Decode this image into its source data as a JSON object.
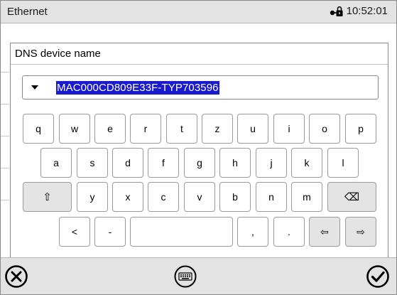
{
  "topbar": {
    "title": "Ethernet",
    "time": "10:52:01",
    "lock_icon": "network-lock-icon"
  },
  "dialog": {
    "title": "DNS device name",
    "field": {
      "value": "MAC000CD809E33F-TYP703596",
      "selected": true,
      "dropdown_icon": "chevron-down-icon"
    }
  },
  "keyboard": {
    "row1": [
      "q",
      "w",
      "e",
      "r",
      "t",
      "z",
      "u",
      "i",
      "o",
      "p"
    ],
    "row2": [
      "a",
      "s",
      "d",
      "f",
      "g",
      "h",
      "j",
      "k",
      "l"
    ],
    "row3": [
      "⇧",
      "y",
      "x",
      "c",
      "v",
      "b",
      "n",
      "m",
      "⌫"
    ],
    "row4": [
      "<",
      "-",
      "",
      ",",
      ".",
      "⇦",
      "⇨"
    ]
  },
  "bottombar": {
    "cancel_icon": "close-circle-icon",
    "keyboard_icon": "keyboard-icon",
    "confirm_icon": "checkmark-circle-icon"
  },
  "colors": {
    "bar_bg": "#e3e3e3",
    "selection": "#1a1acf"
  }
}
